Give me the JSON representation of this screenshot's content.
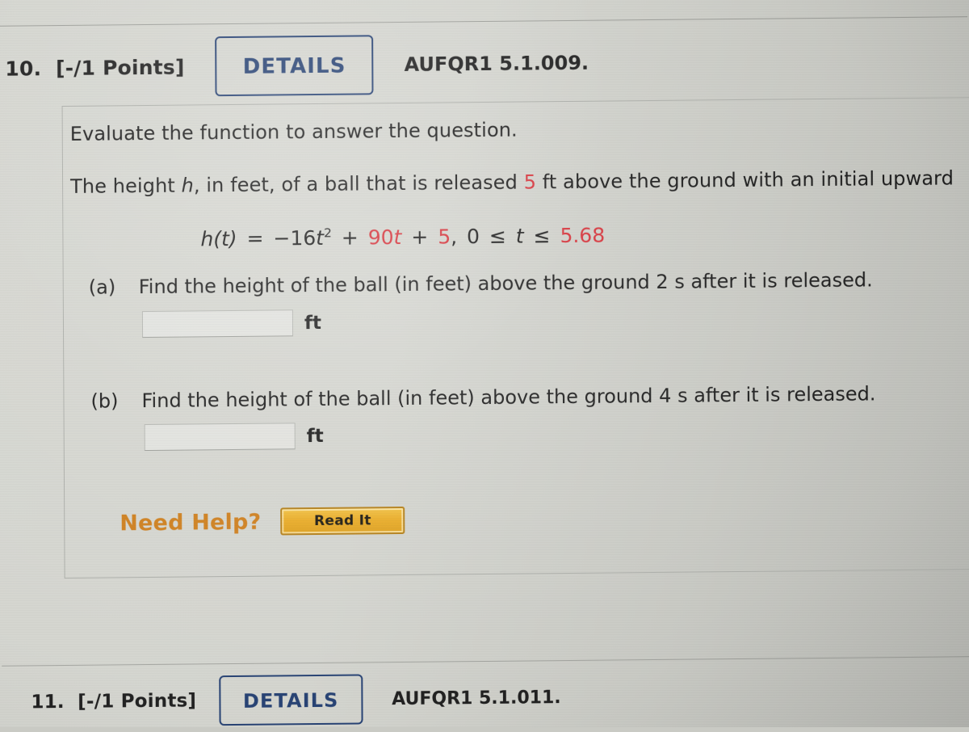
{
  "question_10": {
    "number": "10.",
    "points": "[-/1 Points]",
    "details_label": "DETAILS",
    "code": "AUFQR1 5.1.009.",
    "instruction": "Evaluate the function to answer the question.",
    "stem": {
      "before": "The height ",
      "variable": "h",
      "middle": ", in feet, of a ball that is released ",
      "highlight": "5",
      "after": " ft above the ground with an initial upward"
    },
    "formula": {
      "lhs": "h(t)",
      "equals": "=",
      "term1_sign": "−",
      "term1_coef": "16",
      "term1_var": "t",
      "term1_exp": "2",
      "plus1": "+",
      "term2": "90",
      "term2_var": "t",
      "plus2": "+",
      "constant": "5",
      "comma": ",",
      "domain_low": "0",
      "le1": "≤",
      "domain_var": "t",
      "le2": "≤",
      "domain_high": "5.68"
    },
    "parts": [
      {
        "label": "(a)",
        "text": "Find the height of the ball (in feet) above the ground 2 s after it is released.",
        "answer_value": "",
        "answer_placeholder": "",
        "unit": "ft"
      },
      {
        "label": "(b)",
        "text": "Find the height of the ball (in feet) above the ground 4 s after it is released.",
        "answer_value": "",
        "answer_placeholder": "",
        "unit": "ft"
      }
    ],
    "need_help_label": "Need Help?",
    "read_it_label": "Read It"
  },
  "question_11": {
    "number": "11.",
    "points": "[-/1 Points]",
    "details_label": "DETAILS",
    "code": "AUFQR1 5.1.011."
  },
  "colors": {
    "accent_blue": "#1f3b6e",
    "highlight_red": "#d42b33",
    "need_help_orange": "#cc7a15",
    "read_it_gold": "#e8a81e",
    "page_background": "#d2d3cd",
    "text": "#141414"
  }
}
